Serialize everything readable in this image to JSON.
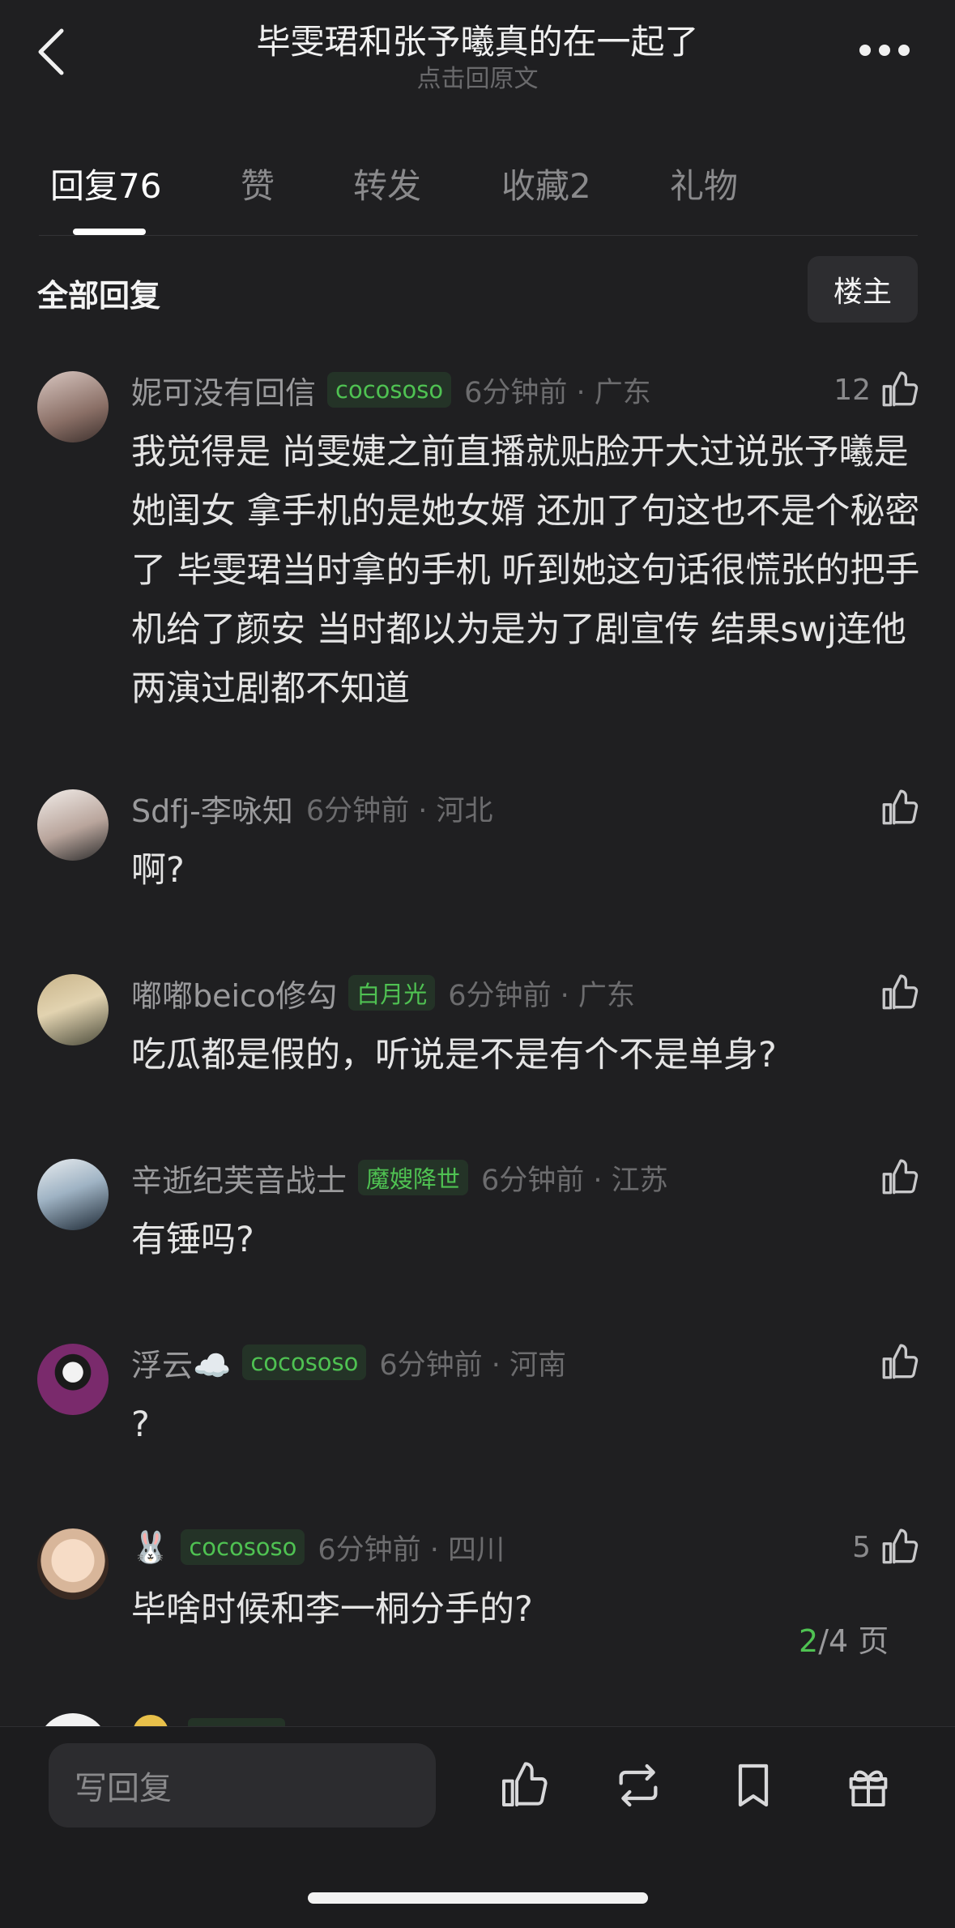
{
  "header": {
    "title": "毕雯珺和张予曦真的在一起了",
    "subtitle": "点击回原文"
  },
  "tabs": [
    {
      "label": "回复",
      "count": "76"
    },
    {
      "label": "赞",
      "count": ""
    },
    {
      "label": "转发",
      "count": ""
    },
    {
      "label": "收藏",
      "count": "2"
    },
    {
      "label": "礼物",
      "count": ""
    }
  ],
  "section": {
    "title": "全部回复",
    "op_button": "楼主"
  },
  "comments": [
    {
      "name": "妮可没有回信",
      "badge": "cocososo",
      "time": "6分钟前 · 广东",
      "likes": "12",
      "text": "我觉得是 尚雯婕之前直播就贴脸开大过说张予曦是她闺女 拿手机的是她女婿 还加了句这也不是个秘密了 毕雯珺当时拿的手机 听到她这句话很慌张的把手机给了颜安 当时都以为是为了剧宣传 结果swj连他两演过剧都不知道"
    },
    {
      "name": "Sdfj-李咏知",
      "badge": "",
      "time": "6分钟前 · 河北",
      "likes": "",
      "text": "啊?"
    },
    {
      "name": "嘟嘟beico修勾",
      "badge": "白月光",
      "time": "6分钟前 · 广东",
      "likes": "",
      "text": "吃瓜都是假的，听说是不是有个不是单身?"
    },
    {
      "name": "辛逝纪芙音战士",
      "badge": "魔嫂降世",
      "time": "6分钟前 · 江苏",
      "likes": "",
      "text": "有锤吗?"
    },
    {
      "name": "浮云☁️",
      "badge": "cocososo",
      "time": "6分钟前 · 河南",
      "likes": "",
      "text": "?"
    },
    {
      "name": "🐰",
      "badge": "cocososo",
      "time": "6分钟前 · 四川",
      "likes": "5",
      "text": "毕啥时候和李一桐分手的?"
    }
  ],
  "pager": {
    "current": "2",
    "total": "/4 页"
  },
  "bottom_bar": {
    "reply_placeholder": "写回复",
    "icons": [
      "like-icon",
      "repost-icon",
      "bookmark-icon",
      "gift-icon"
    ]
  },
  "colors": {
    "background": "#1f1f21",
    "accent_green": "#4fc252"
  }
}
